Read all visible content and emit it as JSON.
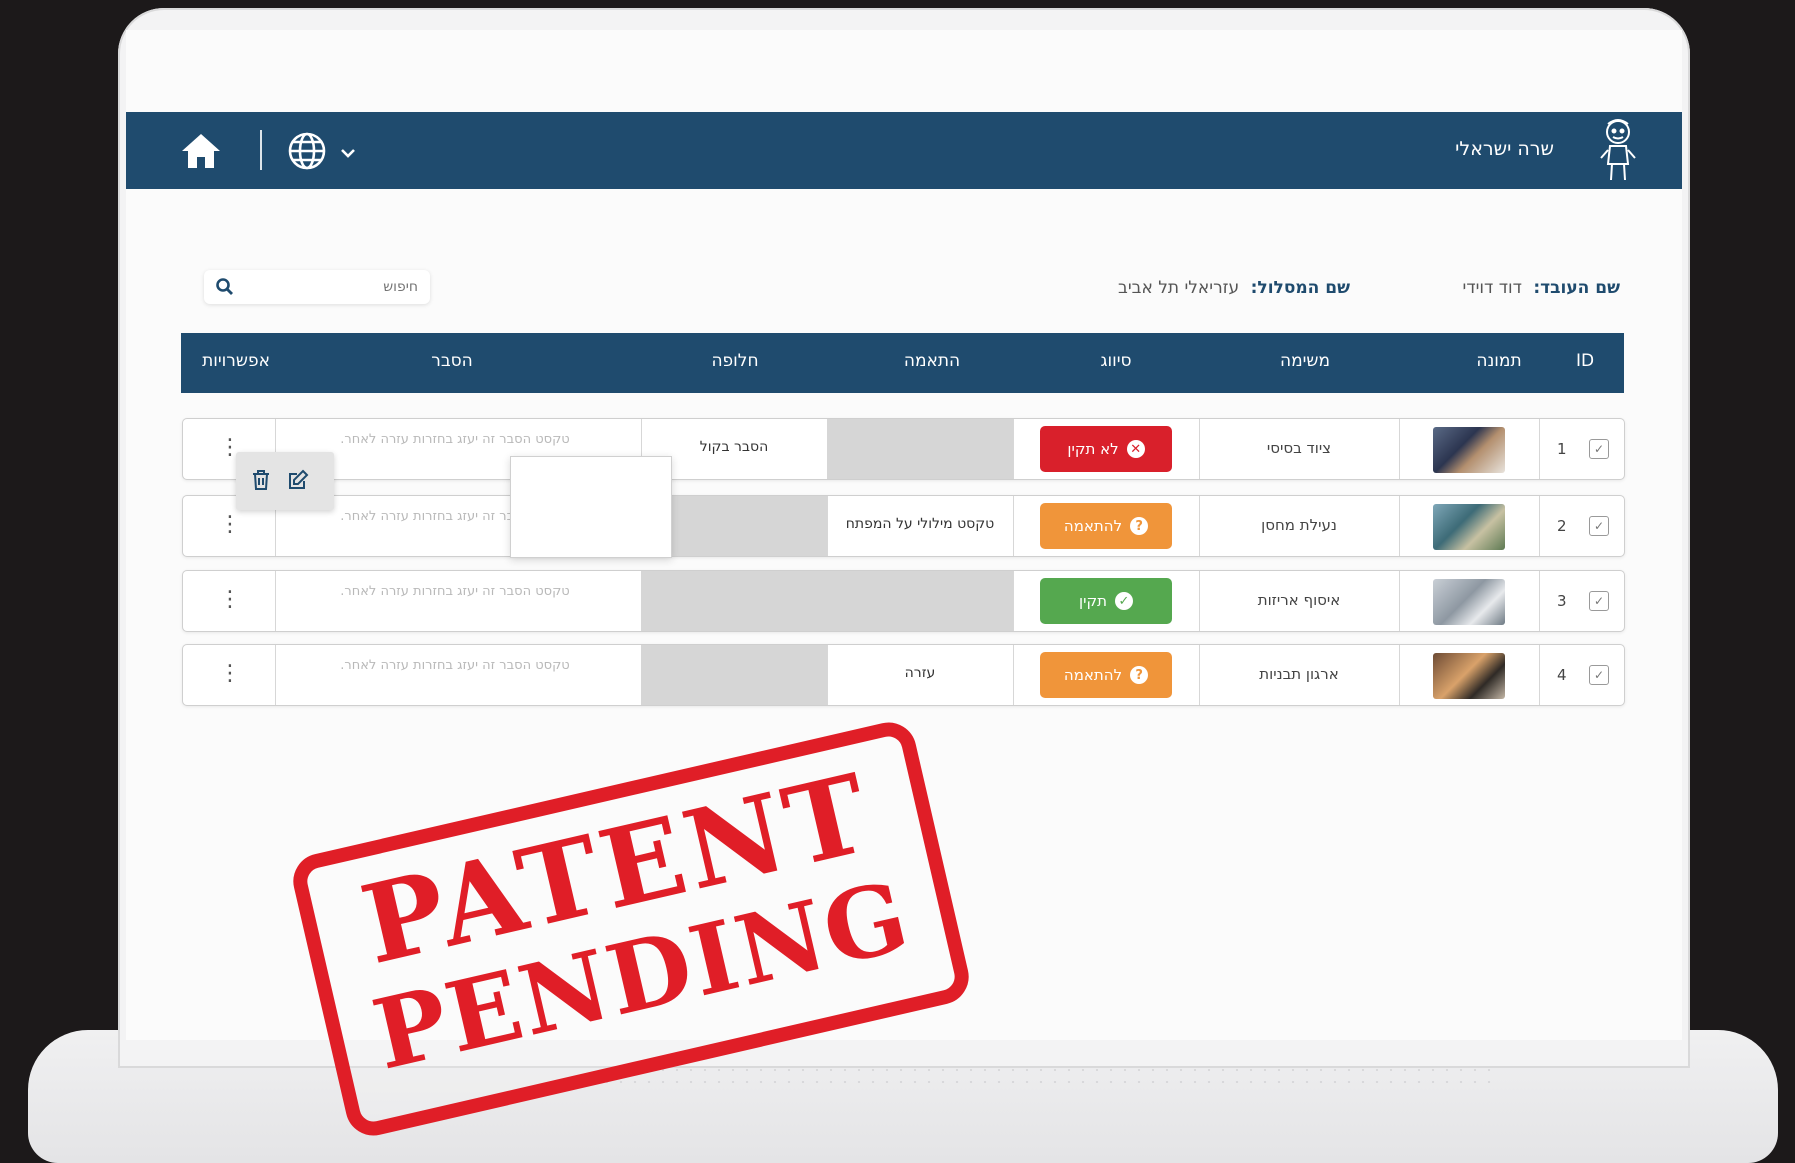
{
  "header": {
    "user_name": "שרה ישראלי",
    "icons": [
      "home-icon",
      "globe-icon",
      "chevron-down-icon",
      "avatar-icon"
    ]
  },
  "info": {
    "worker_label": "שם העובד:",
    "worker_value": "דוד דוידי",
    "route_label": "שם המסלול:",
    "route_value": "עזריאלי תל אביב"
  },
  "search": {
    "placeholder": "חיפוש"
  },
  "table": {
    "columns": [
      "ID",
      "תמונה",
      "משימה",
      "סיווג",
      "התאמה",
      "חלופה",
      "הסבר",
      "אפשרויות"
    ],
    "rows": [
      {
        "id": "1",
        "task": "ציוד בסיסי",
        "status": "לא תקין",
        "status_color": "#d9202b",
        "match": "",
        "alt": "הסבר בקול",
        "explain": "טקסט הסבר זה יעזג בחזרות עזרה לאחר."
      },
      {
        "id": "2",
        "task": "נעילת מחסן",
        "status": "להתאמה",
        "status_color": "#f0953a",
        "match": "טקסט מילולי על המפתח",
        "alt": "",
        "explain": "טקסט הסבר זה יעזג בחזרות עזרה לאחר."
      },
      {
        "id": "3",
        "task": "איסוף אריזות",
        "status": "תקין",
        "status_color": "#55a84f",
        "match": "",
        "alt": "",
        "explain": "טקסט הסבר זה יעזג בחזרות עזרה לאחר."
      },
      {
        "id": "4",
        "task": "ארגון תבניות",
        "status": "להתאמה",
        "status_color": "#f0953a",
        "match": "עזרה",
        "alt": "",
        "explain": "טקסט הסבר זה יעזג בחזרות עזרה לאחר."
      }
    ]
  },
  "stamp": {
    "line1": "PATENT",
    "line2": "PENDING",
    "color": "#e01e27"
  },
  "colors": {
    "brand": "#1f4b6e"
  }
}
